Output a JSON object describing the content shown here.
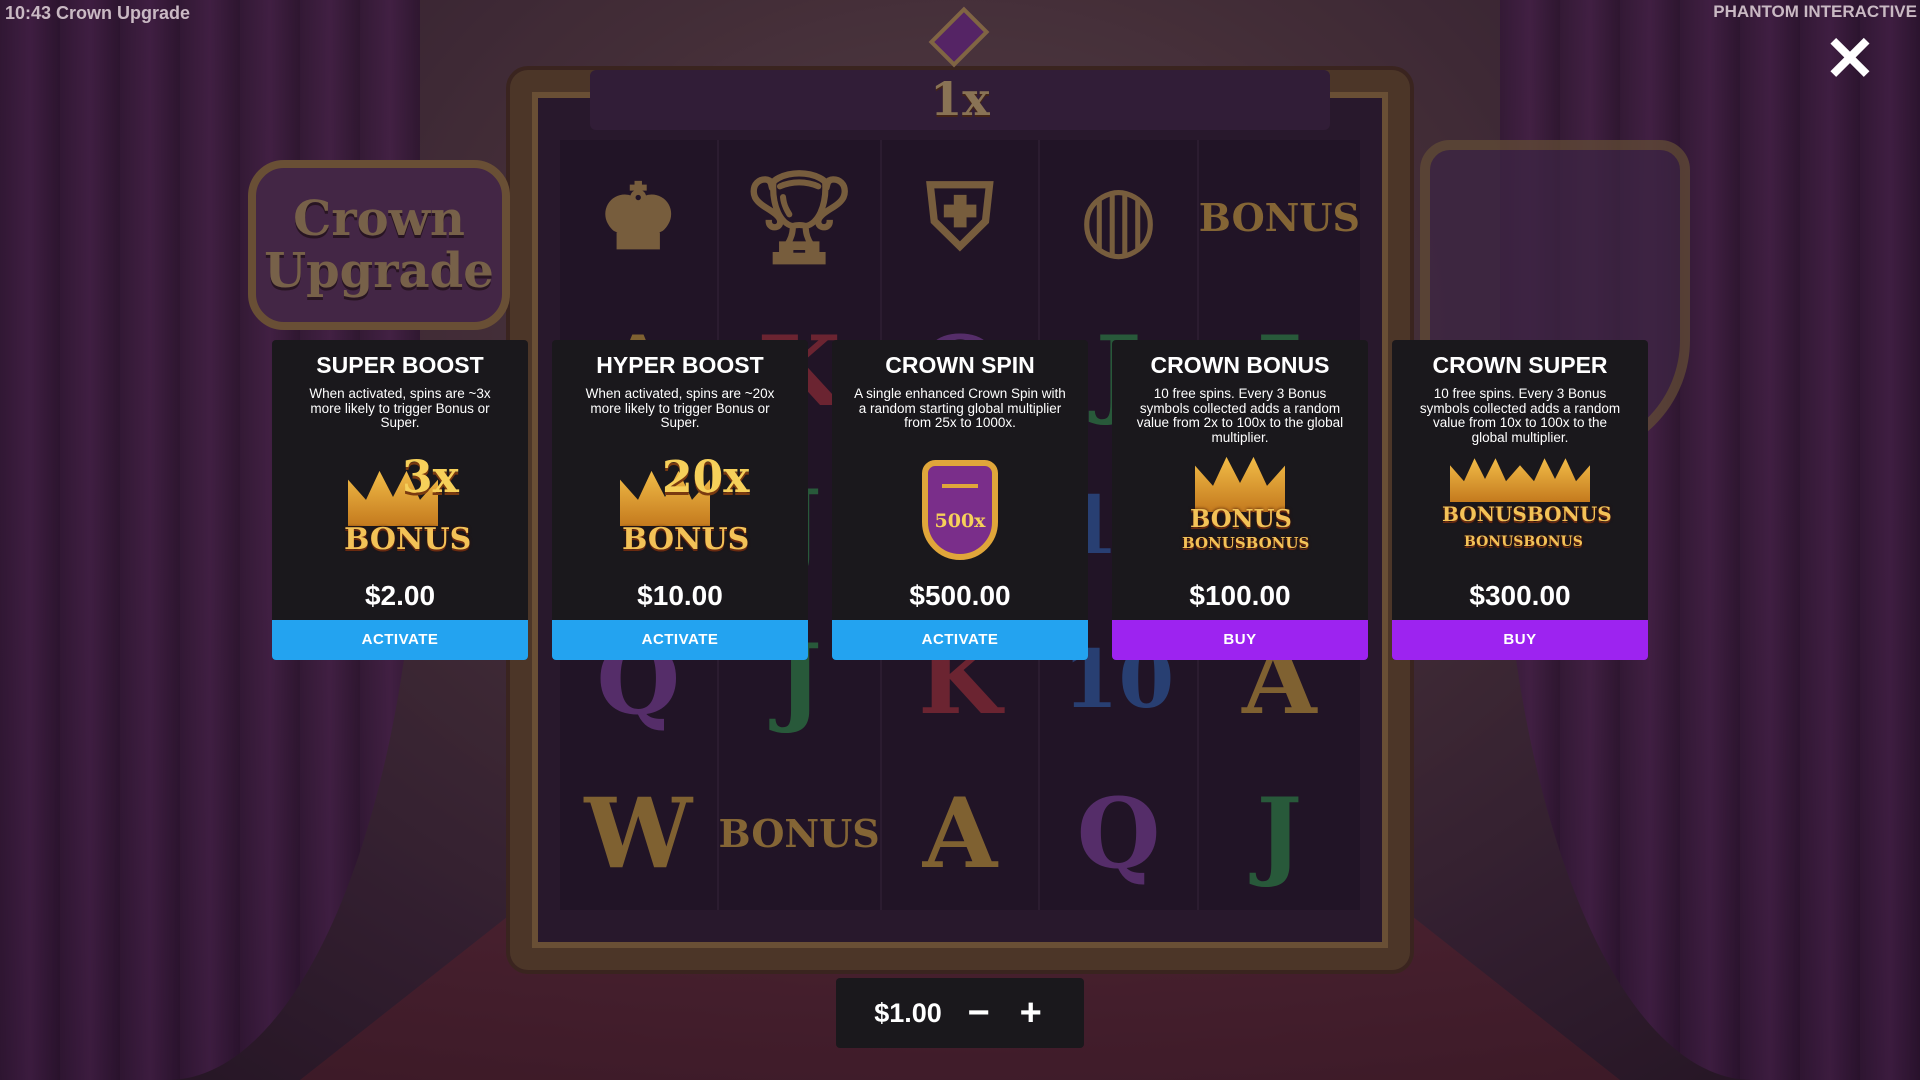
{
  "header": {
    "time_title": "10:43 Crown Upgrade",
    "studio": "PHANTOM INTERACTIVE",
    "close_icon": "✕"
  },
  "game": {
    "multiplier": "1x",
    "logo_line1": "Crown",
    "logo_line2": "Upgrade",
    "reel_symbols": [
      [
        "king-icon",
        "goblet-icon",
        "shield-icon",
        "ring-icon",
        "BONUS"
      ],
      [
        "A",
        "K",
        "Q",
        "J",
        "J"
      ],
      [
        "Q",
        "J",
        "K",
        "10",
        "A"
      ],
      [
        "Q",
        "J",
        "K",
        "10",
        "A"
      ],
      [
        "W",
        "BONUS",
        "A",
        "Q",
        "J"
      ]
    ]
  },
  "cards": [
    {
      "title": "SUPER BOOST",
      "description": "When activated, spins are ~3x more likely to trigger Bonus or Super.",
      "art_multiplier": "3x",
      "art_word": "BONUS",
      "price": "$2.00",
      "button": "ACTIVATE",
      "button_color": "#23a3f0"
    },
    {
      "title": "HYPER BOOST",
      "description": "When activated, spins are ~20x more likely to trigger Bonus or Super.",
      "art_multiplier": "20x",
      "art_word": "BONUS",
      "price": "$10.00",
      "button": "ACTIVATE",
      "button_color": "#23a3f0"
    },
    {
      "title": "CROWN SPIN",
      "description": "A single enhanced Crown Spin with a random starting global multiplier from 25x to 1000x.",
      "art_multiplier": "500x",
      "price": "$500.00",
      "button": "ACTIVATE",
      "button_color": "#23a3f0"
    },
    {
      "title": "CROWN BONUS",
      "description": "10 free spins. Every 3 Bonus symbols collected adds a random value from 2x to 100x to the global multiplier.",
      "art_word": "BONUS",
      "art_word_small": "BONUSBONUS",
      "price": "$100.00",
      "button": "BUY",
      "button_color": "#9d23f0"
    },
    {
      "title": "CROWN SUPER",
      "description": "10 free spins. Every 3 Bonus symbols collected adds a random value from 10x to 100x to the global multiplier.",
      "art_word": "BONUSBONUS",
      "art_word_small": "BONUSBONUS",
      "price": "$300.00",
      "button": "BUY",
      "button_color": "#9d23f0"
    }
  ],
  "bet": {
    "value": "$1.00",
    "minus_icon": "−",
    "plus_icon": "+"
  }
}
